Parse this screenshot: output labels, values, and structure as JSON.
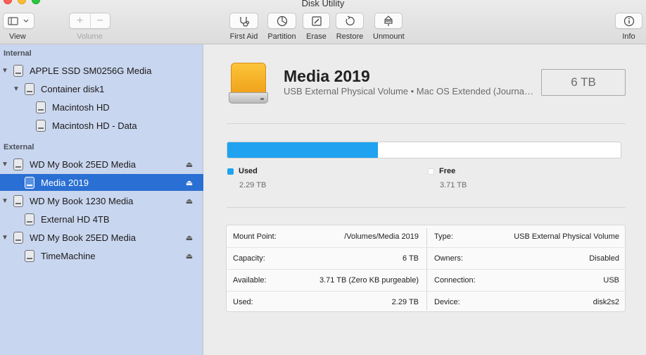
{
  "window": {
    "title": "Disk Utility"
  },
  "toolbar": {
    "view_label": "View",
    "volume_label": "Volume",
    "volume_add": "+",
    "volume_remove": "−",
    "first_aid_label": "First Aid",
    "partition_label": "Partition",
    "erase_label": "Erase",
    "restore_label": "Restore",
    "unmount_label": "Unmount",
    "info_label": "Info"
  },
  "sidebar": {
    "internal_header": "Internal",
    "external_header": "External",
    "items": [
      {
        "label": "APPLE SSD SM0256G Media"
      },
      {
        "label": "Container disk1"
      },
      {
        "label": "Macintosh HD"
      },
      {
        "label": "Macintosh HD - Data"
      },
      {
        "label": "WD My Book 25ED Media"
      },
      {
        "label": "Media 2019"
      },
      {
        "label": "WD My Book 1230 Media"
      },
      {
        "label": "External HD 4TB"
      },
      {
        "label": "WD My Book 25ED Media"
      },
      {
        "label": "TimeMachine"
      }
    ],
    "selected_color": "#2a6fd3"
  },
  "volume": {
    "name": "Media 2019",
    "description": "USB External Physical Volume • Mac OS Extended (Journaled)",
    "size": "6 TB"
  },
  "usage": {
    "used_fraction": 0.382,
    "used_label": "Used",
    "used_value": "2.29 TB",
    "used_color": "#1fa2f0",
    "free_label": "Free",
    "free_value": "3.71 TB",
    "free_color": "#ffffff"
  },
  "info": {
    "left": [
      {
        "key": "Mount Point:",
        "value": "/Volumes/Media 2019"
      },
      {
        "key": "Capacity:",
        "value": "6 TB"
      },
      {
        "key": "Available:",
        "value": "3.71 TB (Zero KB purgeable)"
      },
      {
        "key": "Used:",
        "value": "2.29 TB"
      }
    ],
    "right": [
      {
        "key": "Type:",
        "value": "USB External Physical Volume"
      },
      {
        "key": "Owners:",
        "value": "Disabled"
      },
      {
        "key": "Connection:",
        "value": "USB"
      },
      {
        "key": "Device:",
        "value": "disk2s2"
      }
    ]
  }
}
